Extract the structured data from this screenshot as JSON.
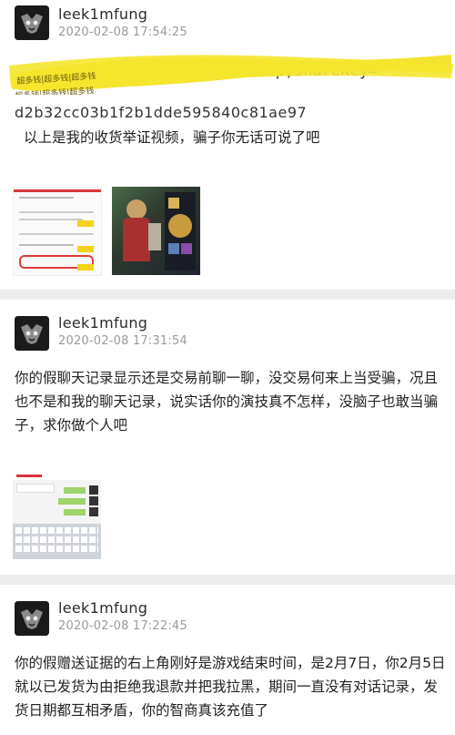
{
  "posts": [
    {
      "username": "leek1mfung",
      "time": "2020-02-08 17:54:25",
      "link_visible": "1d&amp;shareKey=",
      "link_line2": "d2b32cc03b1f2b1dde595840c81ae97",
      "text": "以上是我的收货举证视频，骗子你无话可说了吧",
      "watermark": "超多钱|超多钱|超多钱"
    },
    {
      "username": "leek1mfung",
      "time": "2020-02-08 17:31:54",
      "text": "你的假聊天记录显示还是交易前聊一聊，没交易何来上当受骗，况且也不是和我的聊天记录，说实话你的演技真不怎样，没脑子也敢当骗子，求你做个人吧"
    },
    {
      "username": "leek1mfung",
      "time": "2020-02-08 17:22:45",
      "text": "你的假赠送证据的右上角刚好是游戏结束时间，是2月7日，你2月5日就以已发货为由拒绝我退款并把我拉黑，期间一直没有对话记录，发货日期都互相矛盾，你的智商真该充值了"
    }
  ],
  "colors": {
    "background": "#ececec",
    "card": "#ffffff",
    "censor": "#f3e22a",
    "time": "#9a9a9a"
  }
}
